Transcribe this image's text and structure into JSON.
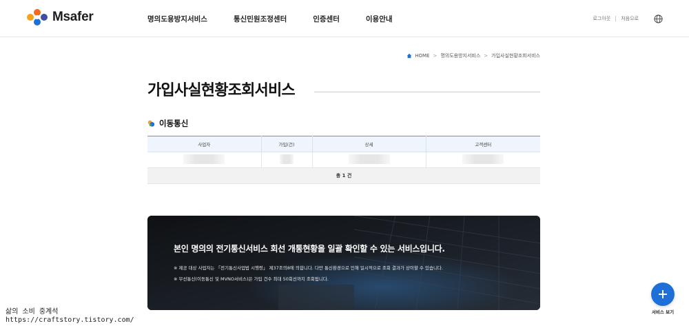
{
  "header": {
    "logo_text": "Msafer",
    "nav": [
      "명의도용방지서비스",
      "통신민원조정센터",
      "인증센터",
      "이용안내"
    ],
    "util": {
      "logout": "로그아웃",
      "home": "처음으로"
    }
  },
  "breadcrumb": [
    "HOME",
    "명의도용방지서비스",
    "가입사실현황조회서비스"
  ],
  "page_title": "가입사실현황조회서비스",
  "section": {
    "title": "이동통신"
  },
  "table": {
    "headers": [
      "사업자",
      "가입(건)",
      "상세",
      "고객센터"
    ],
    "total": "총 1 건"
  },
  "banner": {
    "title": "본인 명의의 전기통신서비스 회선 개통현황을 일괄 확인할 수 있는 서비스입니다.",
    "note1": "※ 제공 대상 사업자는 「전기통신사업법 시행령」 제37조의8에 의합니다. 다만 통신환경으로 인해 일시적으로 조회 결과가 상이할 수 있습니다.",
    "note2": "※ 무선통신(이동통신 및 MVNO서비스)은 가입 건수 최대 50회선까지 조회됩니다."
  },
  "fab": {
    "label": "서비스 보기"
  },
  "watermark": {
    "line1": "삶의 소비 중계석",
    "line2": "https://craftstory.tistory.com/"
  },
  "colors": {
    "accent": "#1f6fd8",
    "table_border": "#5b9ad8",
    "header_bg": "#eef5fc"
  }
}
